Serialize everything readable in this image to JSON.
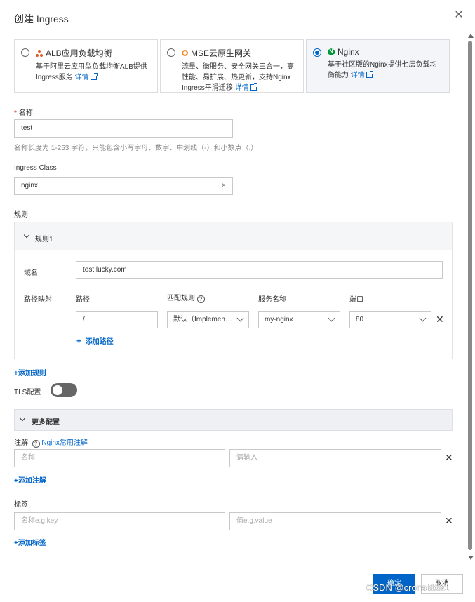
{
  "dialog": {
    "title": "创建 Ingress"
  },
  "cards": [
    {
      "title": "ALB应用负载均衡",
      "desc": "基于阿里云应用型负载均衡ALB提供Ingress服务",
      "link": "详情",
      "selected": false
    },
    {
      "title": "MSE云原生网关",
      "desc": "流量、微服务、安全网关三合一，高性能、易扩展、热更新，支持Nginx Ingress平滑迁移",
      "link": "详情",
      "selected": false
    },
    {
      "title": "Nginx",
      "desc": "基于社区版的Nginx提供七层负载均衡能力",
      "link": "详情",
      "selected": true
    }
  ],
  "name": {
    "label": "名称",
    "value": "test",
    "hint": "名称长度为 1-253 字符，只能包含小写字母、数字、中划线（-）和小数点（.）"
  },
  "ingress_class": {
    "label": "Ingress Class",
    "value": "nginx",
    "clear": "×"
  },
  "rules": {
    "label": "规则",
    "rule1": {
      "title": "规则1",
      "domain_label": "域名",
      "domain_value": "test.lucky.com",
      "path_map_label": "路径映射",
      "col_path": "路径",
      "col_match": "匹配规则",
      "col_service": "服务名称",
      "col_port": "端口",
      "path_value": "/",
      "match_value": "默认（Implemen…",
      "service_value": "my-nginx",
      "port_value": "80",
      "add_path": "添加路径"
    },
    "add_rule": "+添加规则"
  },
  "tls": {
    "label": "TLS配置",
    "enabled": false
  },
  "more": {
    "label": "更多配置",
    "annotation_label": "注解",
    "annotation_link": "Nginx常用注解",
    "annotation_name_ph": "名称",
    "annotation_value_ph": "请输入",
    "add_annotation": "+添加注解",
    "labels_label": "标签",
    "label_name_ph": "名称e.g.key",
    "label_value_ph": "值e.g.value",
    "add_label": "+添加标签"
  },
  "footer": {
    "ok": "确定",
    "cancel": "取消"
  },
  "watermark": "CSDN @cronaldo91",
  "colors": {
    "primary": "#0064c8",
    "alb": "#e0592a",
    "mse": "#f08a24",
    "nginx": "#009639"
  }
}
